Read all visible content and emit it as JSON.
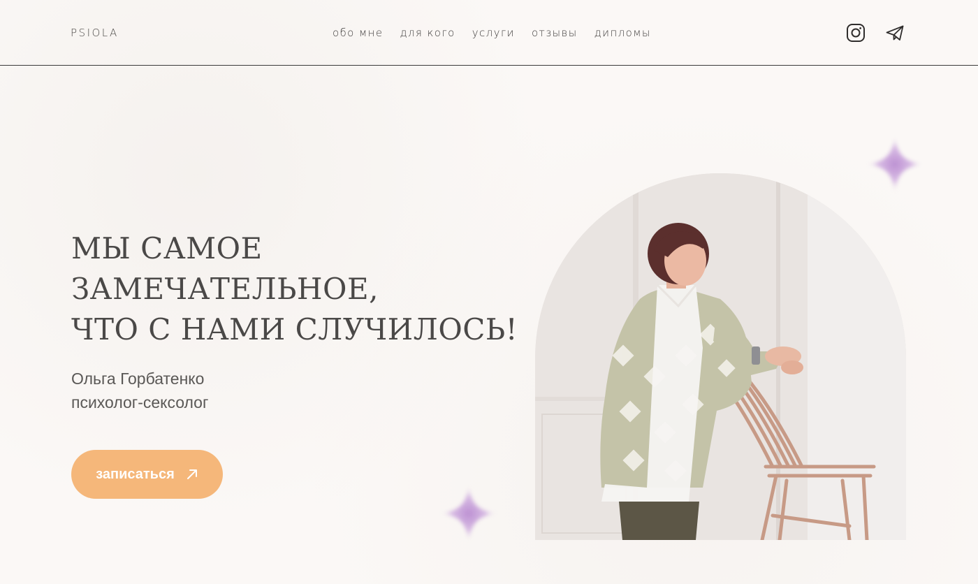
{
  "brand": {
    "logo_text": "PSIOLA"
  },
  "nav": {
    "items": [
      {
        "label": "обо мне"
      },
      {
        "label": "для кого"
      },
      {
        "label": "услуги"
      },
      {
        "label": "отзывы"
      },
      {
        "label": "дипломы"
      }
    ]
  },
  "socials": {
    "instagram_icon": "instagram-icon",
    "telegram_icon": "telegram-icon"
  },
  "hero": {
    "headline_lines": [
      "МЫ САМОЕ",
      "ЗАМЕЧАТЕЛЬНОЕ,",
      "ЧТО С НАМИ СЛУЧИЛОСЬ!"
    ],
    "name": "Ольга Горбатенко",
    "role": "психолог-сексолог",
    "cta_label": "записаться",
    "cta_icon": "arrow-up-right-icon"
  },
  "colors": {
    "background": "#fbf8f6",
    "accent": "#f5b77a",
    "sparkle": "#c79bd6",
    "text": "#4a4847"
  }
}
